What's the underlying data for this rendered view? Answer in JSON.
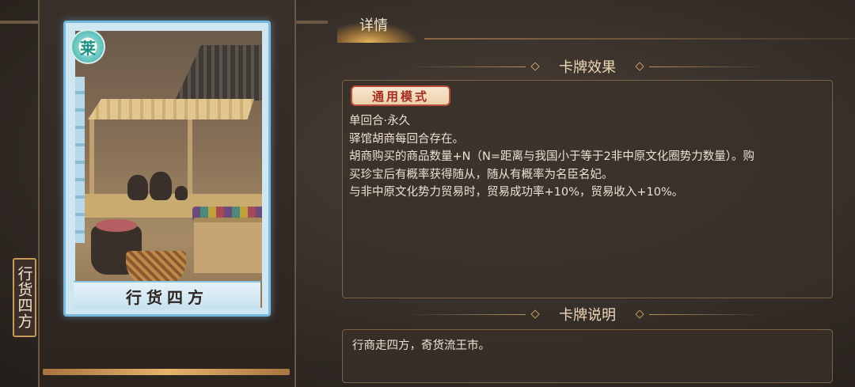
{
  "card": {
    "faction_symbol": "莱",
    "title_plate": "行货四方",
    "side_name": "行货四方"
  },
  "tabs": {
    "details_label": "详情"
  },
  "effect_section": {
    "title": "卡牌效果",
    "mode_badge": "通用模式",
    "lines": [
      "单回合·永久",
      "驿馆胡商每回合存在。",
      "胡商购买的商品数量+N（N=距离与我国小于等于2非中原文化圈势力数量）。购",
      "买珍宝后有概率获得随从，随从有概率为名臣名妃。",
      "与非中原文化势力贸易时，贸易成功率+10%，贸易收入+10%。"
    ]
  },
  "description_section": {
    "title": "卡牌说明",
    "text": "行商走四方，奇货流王市。"
  },
  "colors": {
    "card_border": "#79b9de",
    "accent_gold": "#e6b36c",
    "badge_red": "#a42d22"
  }
}
